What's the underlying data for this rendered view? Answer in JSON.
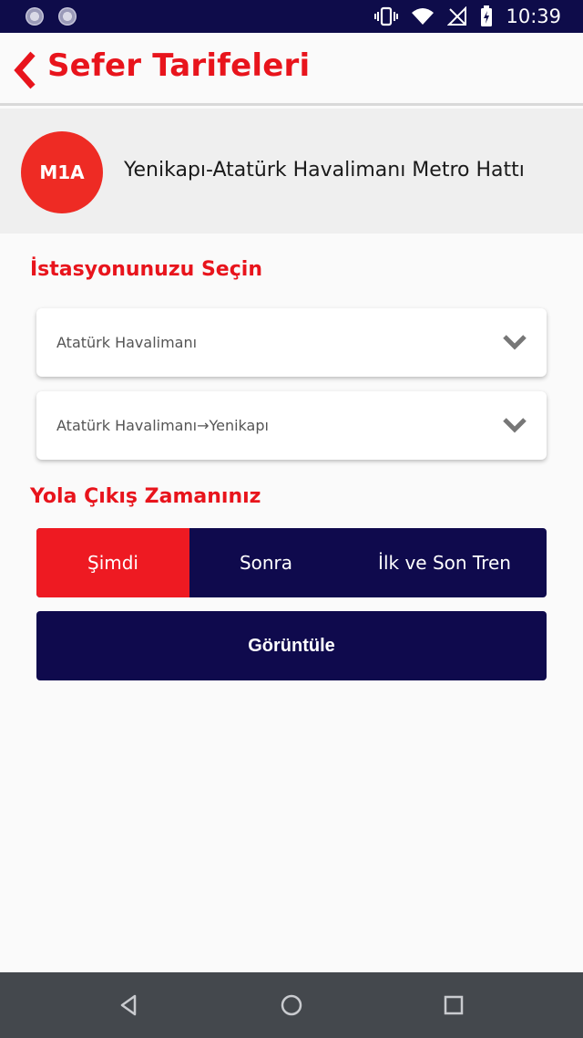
{
  "status_bar": {
    "time": "10:39"
  },
  "header": {
    "title": "Sefer Tarifeleri"
  },
  "line": {
    "code": "M1A",
    "name": "Yenikapı-Atatürk Havalimanı Metro Hattı"
  },
  "station_section": {
    "title": "İstasyonunuzu Seçin",
    "station_select": {
      "value": "Atatürk Havalimanı"
    },
    "direction_select": {
      "value": "Atatürk Havalimanı→Yenikapı"
    }
  },
  "departure_section": {
    "title": "Yola Çıkış Zamanınız",
    "options": [
      {
        "label": "Şimdi",
        "selected": true
      },
      {
        "label": "Sonra",
        "selected": false
      },
      {
        "label": "İlk ve Son Tren",
        "selected": false
      }
    ]
  },
  "actions": {
    "view_label": "Görüntüle"
  },
  "colors": {
    "accent": "#e8141c",
    "navy": "#0f0a4d",
    "status_bar": "#0e0c4a"
  }
}
